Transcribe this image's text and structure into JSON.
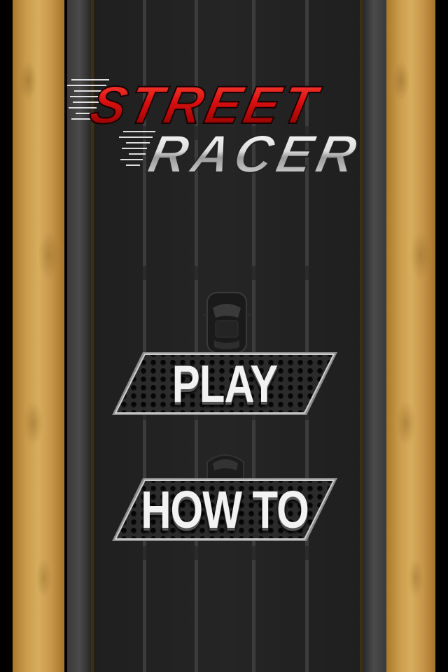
{
  "game": {
    "logo": {
      "line1": "STREET",
      "line2": "RACER",
      "line1_color": "#d80f0f",
      "line2_color": "#e6e6e6"
    },
    "menu": {
      "play_label": "PLAY",
      "howto_label": "HOW TO"
    },
    "colors": {
      "road": "#252525",
      "sand": "#c99a4a",
      "button_plate": "#1e1e1e"
    }
  }
}
